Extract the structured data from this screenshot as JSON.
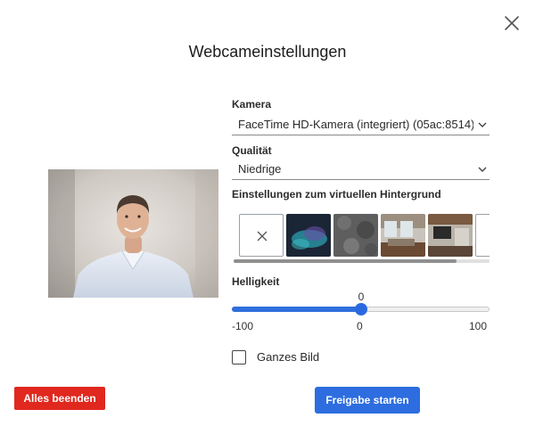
{
  "dialog": {
    "title": "Webcameinstellungen",
    "close_icon": "close-icon"
  },
  "camera": {
    "label": "Kamera",
    "selected": "FaceTime HD-Kamera (integriert) (05ac:8514)"
  },
  "quality": {
    "label": "Qualität",
    "selected": "Niedrige"
  },
  "background": {
    "label": "Einstellungen zum virtuellen Hintergrund",
    "options": [
      {
        "name": "none",
        "icon": "close-icon"
      },
      {
        "name": "abstract-blue-teal"
      },
      {
        "name": "grey-texture"
      },
      {
        "name": "living-room"
      },
      {
        "name": "modern-interior"
      },
      {
        "name": "partial-option"
      }
    ]
  },
  "brightness": {
    "label": "Helligkeit",
    "value": "0",
    "min_label": "-100",
    "mid_label": "0",
    "max_label": "100",
    "min": -100,
    "max": 100,
    "current": 0
  },
  "full_image": {
    "label": "Ganzes Bild",
    "checked": false
  },
  "buttons": {
    "stop_all": "Alles beenden",
    "start_sharing": "Freigabe starten"
  },
  "colors": {
    "primary": "#2d6ddf",
    "danger": "#e0281f"
  }
}
